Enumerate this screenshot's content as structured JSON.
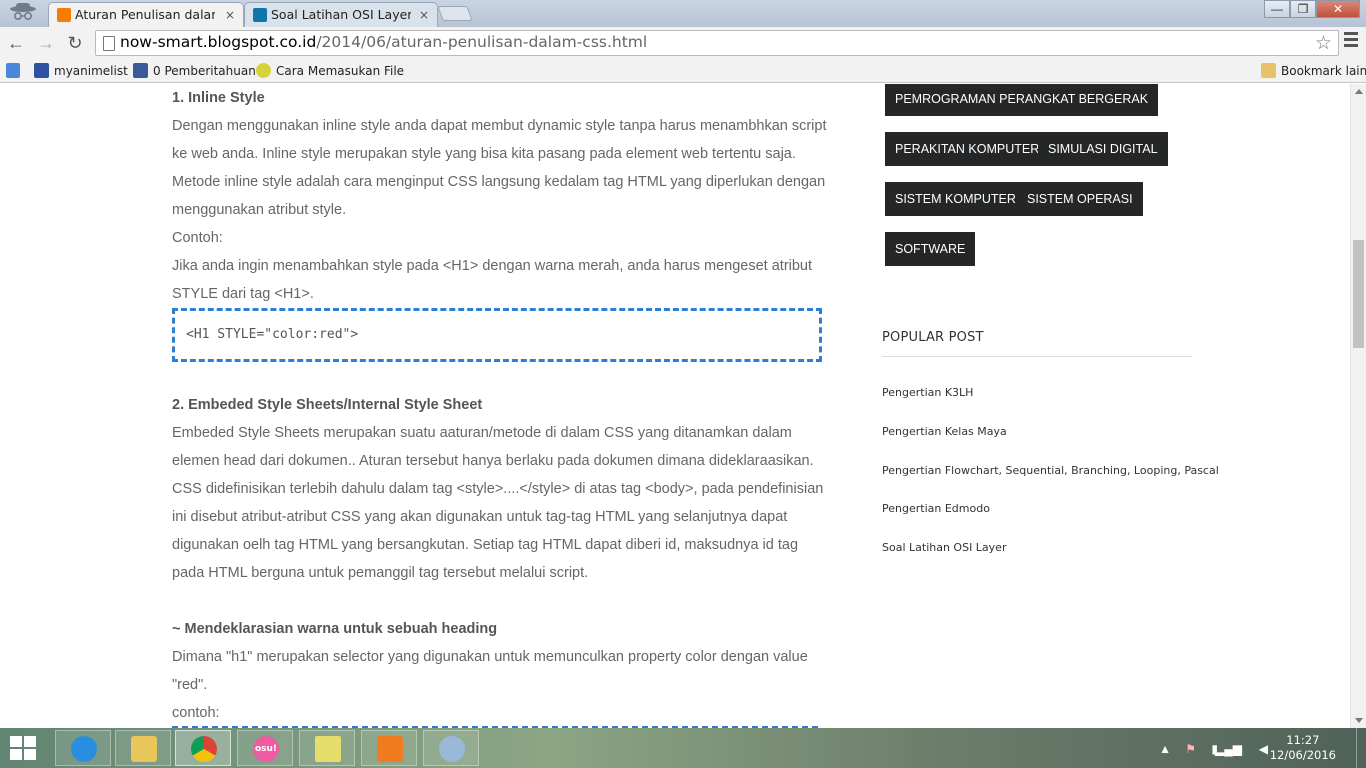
{
  "browser": {
    "tabs": [
      {
        "title": "Aturan Penulisan dalam C",
        "favicon_color": "#f57d00",
        "active": true
      },
      {
        "title": "Soal Latihan OSI Layer",
        "favicon_color": "#0e76a8",
        "active": false
      }
    ],
    "tab_close": "×",
    "window_controls": {
      "minimize": "—",
      "maximize": "❐",
      "close": "✕"
    },
    "url_host": "now-smart.blogspot.co.id",
    "url_path": "/2014/06/aturan-penulisan-dalam-css.html",
    "nav": {
      "back": "←",
      "forward": "→",
      "reload": "↻"
    },
    "star": "☆"
  },
  "bookmarks": {
    "items": [
      {
        "label": "myanimelist",
        "icon": "mal-icon"
      },
      {
        "label": "0 Pemberitahuan",
        "icon": "facebook-icon"
      },
      {
        "label": "Cara Memasukan File",
        "icon": "site-icon"
      }
    ],
    "other": "Bookmark lain"
  },
  "article": {
    "lines": [
      {
        "text": "1. Inline Style",
        "heading": true
      },
      {
        "text": "Dengan menggunakan inline style anda dapat membut dynamic style tanpa harus menambhkan script"
      },
      {
        "text": "ke web anda. Inline style merupakan style yang bisa kita pasang pada element web tertentu saja."
      },
      {
        "text": "Metode inline style adalah cara menginput CSS langsung kedalam tag HTML yang diperlukan dengan"
      },
      {
        "text": "menggunakan atribut style."
      },
      {
        "text": "Contoh:"
      },
      {
        "text": "Jika anda ingin menambahkan style pada <H1> dengan warna merah, anda harus mengeset atribut"
      },
      {
        "text": "STYLE dari tag <H1>."
      }
    ],
    "code1": "<H1 STYLE=\"color:red\">",
    "lines2": [
      {
        "text": "2. Embeded Style Sheets/Internal Style Sheet",
        "heading": true
      },
      {
        "text": "Embeded Style Sheets merupakan suatu aaturan/metode di dalam CSS yang ditanamkan dalam"
      },
      {
        "text": "elemen head dari dokumen.. Aturan tersebut hanya berlaku pada dokumen dimana dideklaraasikan."
      },
      {
        "text": "CSS didefinisikan terlebih dahulu dalam tag <style>....</style> di atas tag <body>, pada pendefinisian"
      },
      {
        "text": "ini disebut atribut-atribut CSS yang akan digunakan untuk tag-tag HTML yang selanjutnya dapat"
      },
      {
        "text": "digunakan oelh tag HTML yang bersangkutan. Setiap tag HTML dapat diberi id, maksudnya id tag"
      },
      {
        "text": "pada HTML berguna untuk pemanggil tag tersebut melalui script."
      }
    ],
    "lines3": [
      {
        "text": "~ Mendeklarasian warna untuk sebuah heading",
        "heading": true
      },
      {
        "text": "Dimana \"h1\" merupakan selector yang digunakan untuk memunculkan property color dengan value"
      },
      {
        "text": "\"red\"."
      },
      {
        "text": "contoh:"
      }
    ]
  },
  "sidebar": {
    "tags": [
      "PEMROGRAMAN PERANGKAT BERGERAK",
      "PERAKITAN KOMPUTER",
      "SIMULASI DIGITAL",
      "SISTEM KOMPUTER",
      "SISTEM OPERASI",
      "SOFTWARE"
    ],
    "popular_title": "POPULAR POST",
    "popular_posts": [
      "Pengertian K3LH",
      "Pengertian Kelas Maya",
      "Pengertian Flowchart, Sequential, Branching, Looping, Pascal",
      "Pengertian Edmodo",
      "Soal Latihan OSI Layer"
    ]
  },
  "taskbar": {
    "apps": [
      {
        "name": "internet-explorer",
        "color": "#2a8ee0"
      },
      {
        "name": "file-explorer",
        "color": "#e8c65a"
      },
      {
        "name": "chrome",
        "color": "#4a8af4"
      },
      {
        "name": "osu",
        "color": "#ee5ba1",
        "label": "osu!"
      },
      {
        "name": "sticky-notes",
        "color": "#e6dd6a"
      },
      {
        "name": "foxit-pdf",
        "color": "#f07c22"
      },
      {
        "name": "paint",
        "color": "#9ab9d8"
      }
    ],
    "time": "11:27",
    "date": "12/06/2016"
  }
}
